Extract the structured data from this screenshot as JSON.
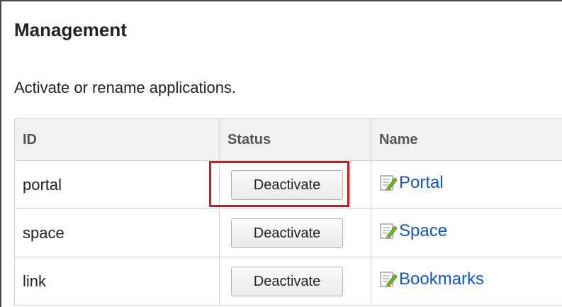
{
  "page": {
    "title": "Management",
    "description": "Activate or rename applications."
  },
  "table": {
    "headers": {
      "id": "ID",
      "status": "Status",
      "name": "Name"
    },
    "rows": [
      {
        "id": "portal",
        "status_button": "Deactivate",
        "name": "Portal",
        "highlighted": true
      },
      {
        "id": "space",
        "status_button": "Deactivate",
        "name": "Space",
        "highlighted": false
      },
      {
        "id": "link",
        "status_button": "Deactivate",
        "name": "Bookmarks",
        "highlighted": false
      }
    ]
  },
  "icons": {
    "rename": "edit-pencil-icon"
  },
  "colors": {
    "link": "#1155cc",
    "highlight": "#e0151b",
    "header_bg": "#f1f1f1"
  }
}
